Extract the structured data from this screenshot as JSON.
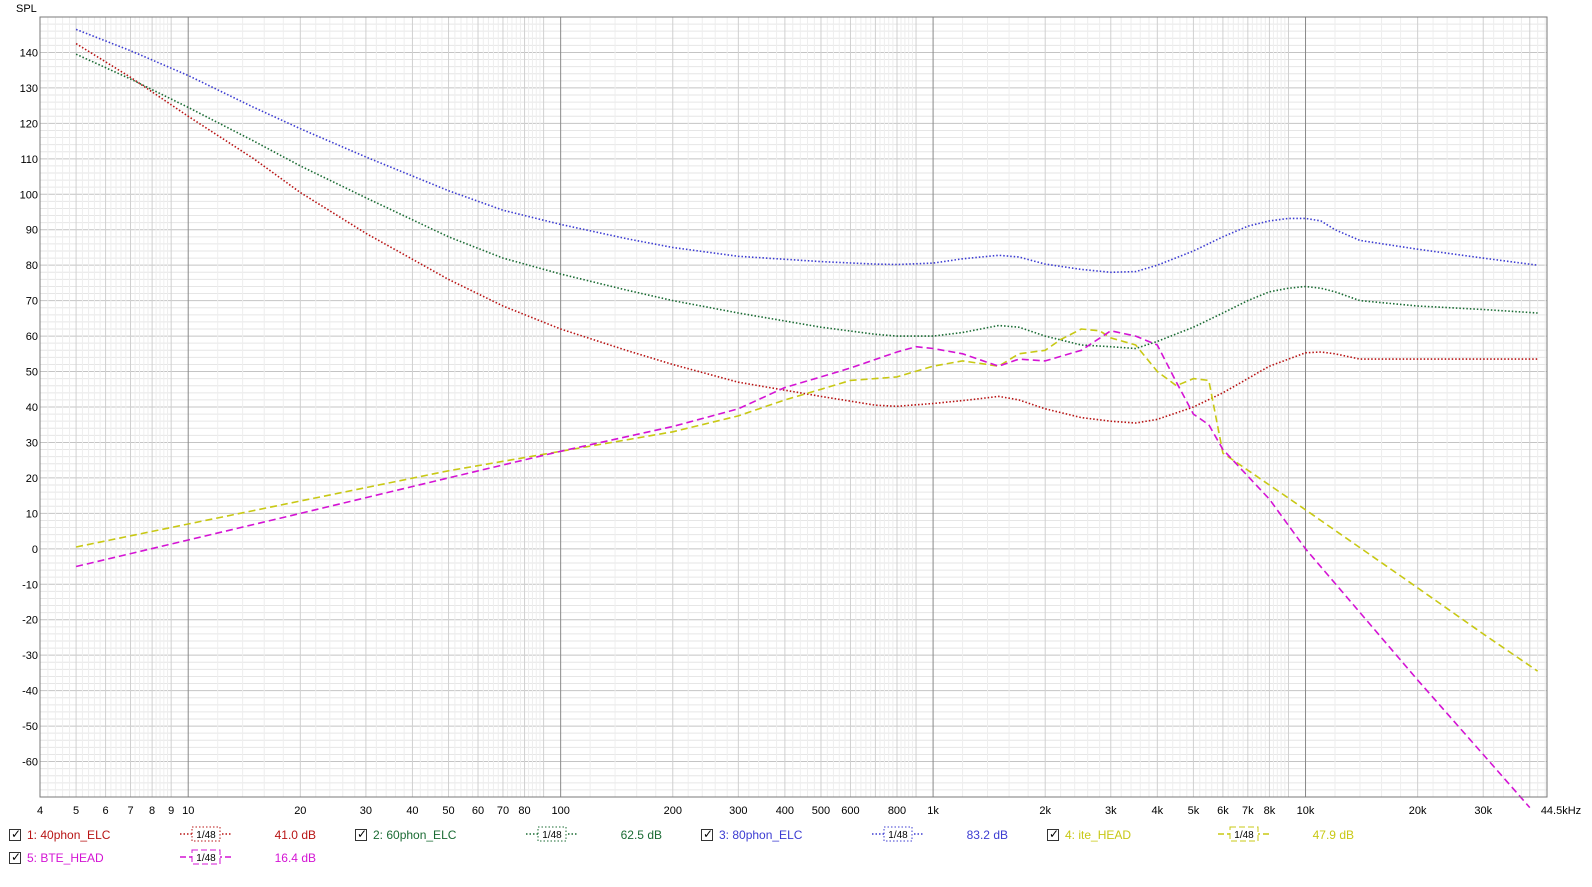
{
  "chart_data": {
    "type": "line",
    "ylabel": "SPL",
    "x_scale": "log",
    "xlim": [
      4,
      44500
    ],
    "ylim": [
      -70,
      150
    ],
    "grid": true,
    "x_ticks": [
      {
        "v": 4,
        "label": "4"
      },
      {
        "v": 5,
        "label": "5"
      },
      {
        "v": 6,
        "label": "6"
      },
      {
        "v": 7,
        "label": "7"
      },
      {
        "v": 8,
        "label": "8"
      },
      {
        "v": 9,
        "label": "9"
      },
      {
        "v": 10,
        "label": "10"
      },
      {
        "v": 20,
        "label": "20"
      },
      {
        "v": 30,
        "label": "30"
      },
      {
        "v": 40,
        "label": "40"
      },
      {
        "v": 50,
        "label": "50"
      },
      {
        "v": 60,
        "label": "60"
      },
      {
        "v": 70,
        "label": "70"
      },
      {
        "v": 80,
        "label": "80"
      },
      {
        "v": 100,
        "label": "100"
      },
      {
        "v": 200,
        "label": "200"
      },
      {
        "v": 300,
        "label": "300"
      },
      {
        "v": 400,
        "label": "400"
      },
      {
        "v": 500,
        "label": "500"
      },
      {
        "v": 600,
        "label": "600"
      },
      {
        "v": 800,
        "label": "800"
      },
      {
        "v": 1000,
        "label": "1k"
      },
      {
        "v": 2000,
        "label": "2k"
      },
      {
        "v": 3000,
        "label": "3k"
      },
      {
        "v": 4000,
        "label": "4k"
      },
      {
        "v": 5000,
        "label": "5k"
      },
      {
        "v": 6000,
        "label": "6k"
      },
      {
        "v": 7000,
        "label": "7k"
      },
      {
        "v": 8000,
        "label": "8k"
      },
      {
        "v": 10000,
        "label": "10k"
      },
      {
        "v": 20000,
        "label": "20k"
      },
      {
        "v": 30000,
        "label": "30k"
      },
      {
        "v": 44500,
        "label": "44.5kHz"
      }
    ],
    "y_ticks": [
      140,
      130,
      120,
      110,
      100,
      90,
      80,
      70,
      60,
      50,
      40,
      30,
      20,
      10,
      0,
      -10,
      -20,
      -30,
      -40,
      -50,
      -60
    ],
    "series": [
      {
        "name": "1: 40phon_ELC",
        "color": "#b81414",
        "dash": "dotted",
        "points": [
          [
            5,
            142.5
          ],
          [
            7,
            133
          ],
          [
            10,
            122
          ],
          [
            15,
            110
          ],
          [
            20,
            100.5
          ],
          [
            30,
            89
          ],
          [
            50,
            76
          ],
          [
            70,
            68.5
          ],
          [
            100,
            62
          ],
          [
            150,
            56
          ],
          [
            200,
            52
          ],
          [
            300,
            47
          ],
          [
            500,
            43
          ],
          [
            700,
            40.5
          ],
          [
            800,
            40.2
          ],
          [
            1000,
            41
          ],
          [
            1250,
            42
          ],
          [
            1500,
            43
          ],
          [
            1700,
            42
          ],
          [
            2000,
            39.5
          ],
          [
            2500,
            37
          ],
          [
            3000,
            36
          ],
          [
            3500,
            35.5
          ],
          [
            4000,
            36.5
          ],
          [
            5000,
            40
          ],
          [
            6000,
            44
          ],
          [
            7000,
            48
          ],
          [
            8000,
            51.5
          ],
          [
            9000,
            53.5
          ],
          [
            10000,
            55.3
          ],
          [
            11000,
            55.5
          ],
          [
            12000,
            55
          ],
          [
            14000,
            53.5
          ],
          [
            20000,
            53.5
          ],
          [
            30000,
            53.5
          ],
          [
            42000,
            53.5
          ]
        ]
      },
      {
        "name": "2: 60phon_ELC",
        "color": "#1a6b33",
        "dash": "dotted",
        "points": [
          [
            5,
            139.5
          ],
          [
            7,
            132.5
          ],
          [
            10,
            124.5
          ],
          [
            15,
            115
          ],
          [
            20,
            108
          ],
          [
            30,
            99
          ],
          [
            50,
            88
          ],
          [
            70,
            82
          ],
          [
            100,
            77.5
          ],
          [
            150,
            73
          ],
          [
            200,
            70
          ],
          [
            300,
            66.5
          ],
          [
            500,
            62.5
          ],
          [
            700,
            60.5
          ],
          [
            800,
            60
          ],
          [
            1000,
            60
          ],
          [
            1200,
            61
          ],
          [
            1500,
            63
          ],
          [
            1700,
            62.5
          ],
          [
            2000,
            60
          ],
          [
            2500,
            57.5
          ],
          [
            3000,
            57
          ],
          [
            3500,
            56.5
          ],
          [
            4000,
            58.5
          ],
          [
            5000,
            62.5
          ],
          [
            6000,
            66.5
          ],
          [
            7000,
            70
          ],
          [
            8000,
            72.5
          ],
          [
            9000,
            73.5
          ],
          [
            10000,
            74
          ],
          [
            11000,
            73.5
          ],
          [
            12000,
            72.5
          ],
          [
            14000,
            70
          ],
          [
            20000,
            68.5
          ],
          [
            30000,
            67.5
          ],
          [
            42000,
            66.5
          ]
        ]
      },
      {
        "name": "3: 80phon_ELC",
        "color": "#3c3cd2",
        "dash": "dotted",
        "points": [
          [
            5,
            146.5
          ],
          [
            7,
            140.5
          ],
          [
            10,
            133.5
          ],
          [
            15,
            124.5
          ],
          [
            20,
            118.5
          ],
          [
            30,
            110.5
          ],
          [
            50,
            101
          ],
          [
            70,
            95.5
          ],
          [
            100,
            91.5
          ],
          [
            150,
            87.5
          ],
          [
            200,
            85
          ],
          [
            300,
            82.5
          ],
          [
            500,
            81
          ],
          [
            700,
            80.3
          ],
          [
            800,
            80.2
          ],
          [
            1000,
            80.6
          ],
          [
            1200,
            81.8
          ],
          [
            1500,
            82.8
          ],
          [
            1700,
            82.3
          ],
          [
            2000,
            80.3
          ],
          [
            2500,
            78.8
          ],
          [
            3000,
            78
          ],
          [
            3500,
            78.2
          ],
          [
            4000,
            80
          ],
          [
            5000,
            84
          ],
          [
            6000,
            88
          ],
          [
            7000,
            91
          ],
          [
            8000,
            92.5
          ],
          [
            9000,
            93.2
          ],
          [
            10000,
            93.2
          ],
          [
            11000,
            92.5
          ],
          [
            12000,
            90
          ],
          [
            14000,
            87
          ],
          [
            20000,
            84.5
          ],
          [
            30000,
            82
          ],
          [
            42000,
            80
          ]
        ]
      },
      {
        "name": "4: ite_HEAD",
        "color": "#c8c814",
        "dash": "dashed",
        "points": [
          [
            5,
            0.5
          ],
          [
            10,
            7
          ],
          [
            20,
            13.5
          ],
          [
            50,
            22
          ],
          [
            100,
            27.5
          ],
          [
            200,
            33
          ],
          [
            300,
            37.5
          ],
          [
            400,
            42
          ],
          [
            500,
            45
          ],
          [
            600,
            47.5
          ],
          [
            700,
            48
          ],
          [
            800,
            48.5
          ],
          [
            1000,
            51.5
          ],
          [
            1200,
            53
          ],
          [
            1400,
            52
          ],
          [
            1500,
            51.5
          ],
          [
            1700,
            55
          ],
          [
            2000,
            56
          ],
          [
            2200,
            59
          ],
          [
            2500,
            62
          ],
          [
            2800,
            61.5
          ],
          [
            3000,
            59.5
          ],
          [
            3500,
            57.5
          ],
          [
            4000,
            50
          ],
          [
            4500,
            46
          ],
          [
            5000,
            48
          ],
          [
            5500,
            47.5
          ],
          [
            6000,
            27
          ],
          [
            10000,
            11
          ],
          [
            20000,
            -11
          ],
          [
            30000,
            -24
          ],
          [
            42000,
            -34.5
          ]
        ]
      },
      {
        "name": "5: BTE_HEAD",
        "color": "#d414d4",
        "dash": "dashed",
        "points": [
          [
            5,
            -5
          ],
          [
            10,
            2.5
          ],
          [
            20,
            10
          ],
          [
            50,
            20
          ],
          [
            100,
            27.5
          ],
          [
            200,
            34.5
          ],
          [
            300,
            39.5
          ],
          [
            400,
            45.5
          ],
          [
            500,
            48.5
          ],
          [
            600,
            51
          ],
          [
            800,
            55.5
          ],
          [
            900,
            57
          ],
          [
            1000,
            56.5
          ],
          [
            1200,
            55
          ],
          [
            1500,
            51.5
          ],
          [
            1700,
            53.5
          ],
          [
            2000,
            53
          ],
          [
            2500,
            56
          ],
          [
            3000,
            61.5
          ],
          [
            3500,
            60
          ],
          [
            4000,
            57.5
          ],
          [
            4500,
            47
          ],
          [
            5000,
            38
          ],
          [
            5500,
            35
          ],
          [
            6000,
            28
          ],
          [
            8000,
            14
          ],
          [
            10000,
            0
          ],
          [
            20000,
            -37
          ],
          [
            30000,
            -58
          ],
          [
            40000,
            -73
          ]
        ]
      }
    ]
  },
  "legend": [
    {
      "name": "1: 40phon_ELC",
      "smoothing": "1/48",
      "value": "41.0 dB",
      "color": "#b81414",
      "dash": "dotted"
    },
    {
      "name": "2: 60phon_ELC",
      "smoothing": "1/48",
      "value": "62.5 dB",
      "color": "#1a6b33",
      "dash": "dotted"
    },
    {
      "name": "3: 80phon_ELC",
      "smoothing": "1/48",
      "value": "83.2 dB",
      "color": "#3c3cd2",
      "dash": "dotted"
    },
    {
      "name": "4: ite_HEAD",
      "smoothing": "1/48",
      "value": "47.9 dB",
      "color": "#c8c814",
      "dash": "dashed"
    },
    {
      "name": "5: BTE_HEAD",
      "smoothing": "1/48",
      "value": "16.4 dB",
      "color": "#d414d4",
      "dash": "dashed"
    }
  ]
}
